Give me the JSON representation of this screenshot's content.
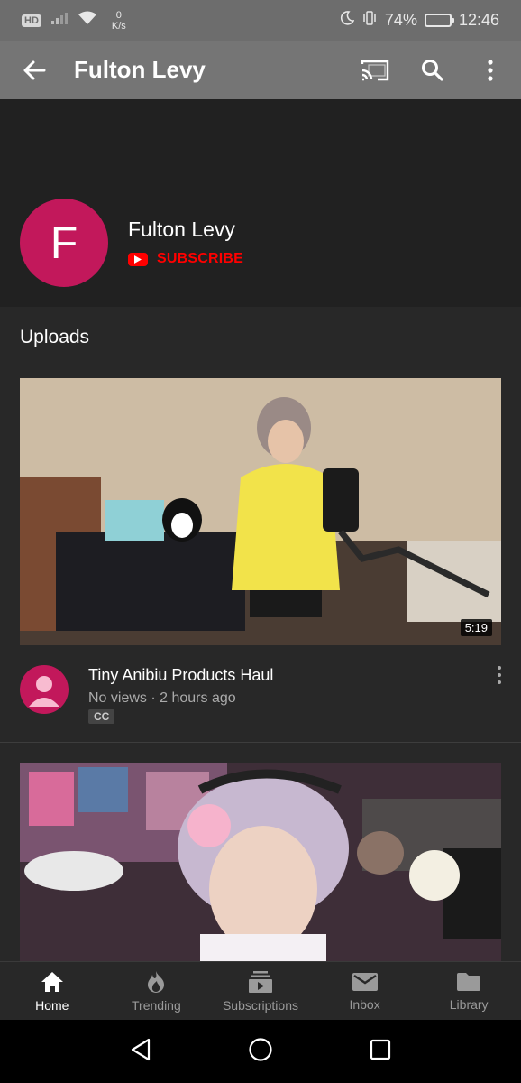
{
  "status_bar": {
    "hd": "HD",
    "net_speed_value": "0",
    "net_speed_unit": "K/s",
    "battery_percent": "74%",
    "battery_level": 0.74,
    "time": "12:46"
  },
  "app_bar": {
    "title": "Fulton Levy"
  },
  "channel": {
    "avatar_letter": "F",
    "name": "Fulton Levy",
    "subscribe_label": "SUBSCRIBE"
  },
  "uploads": {
    "section_title": "Uploads",
    "videos": [
      {
        "duration": "5:19",
        "title": "Tiny Anibiu Products Haul",
        "meta": "No views · 2 hours ago",
        "badge": "CC"
      }
    ]
  },
  "bottom_nav": {
    "items": [
      {
        "label": "Home",
        "icon": "home-icon",
        "active": true
      },
      {
        "label": "Trending",
        "icon": "fire-icon",
        "active": false
      },
      {
        "label": "Subscriptions",
        "icon": "subscriptions-icon",
        "active": false
      },
      {
        "label": "Inbox",
        "icon": "mail-icon",
        "active": false
      },
      {
        "label": "Library",
        "icon": "folder-icon",
        "active": false
      }
    ]
  },
  "colors": {
    "accent": "#ff0000",
    "avatar": "#c2185b",
    "app_bar": "#757575",
    "status_bar": "#6d6d6d",
    "background": "#212121"
  }
}
